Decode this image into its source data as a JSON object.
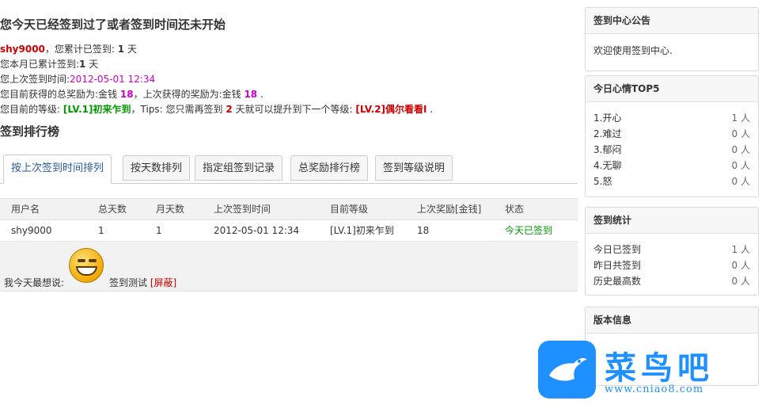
{
  "header": {
    "title": "您今天已经签到过了或者签到时间还未开始"
  },
  "info": {
    "username": "shy9000",
    "total_prefix": "，您累计已签到:",
    "total_days": "1",
    "day_unit": "天",
    "month_prefix": "您本月已累计签到:",
    "month_days": "1",
    "last_prefix": "您上次签到时间:",
    "last_time": "2012-05-01 12:34",
    "reward_prefix": "您目前获得的总奖励为:金钱",
    "reward_total": "18",
    "reward_mid": "，上次获得的奖励为:金钱",
    "reward_last": "18",
    "level_prefix": "您目前的等级:",
    "level_current": "[LV.1]初来乍到",
    "tips_prefix": "，Tips: 您只需再签到",
    "tips_days": "2",
    "tips_mid": "天就可以提升到下一个等级:",
    "level_next": "[LV.2]偶尔看看I",
    "period": "."
  },
  "rank": {
    "title": "签到排行榜",
    "tabs": [
      "按上次签到时间排列",
      "按天数排列",
      "指定组签到记录",
      "总奖励排行榜",
      "签到等级说明"
    ],
    "columns": [
      "用户名",
      "总天数",
      "月天数",
      "上次签到时间",
      "目前等级",
      "上次奖励[金钱]",
      "状态"
    ],
    "rows": [
      [
        "shy9000",
        "1",
        "1",
        "2012-05-01 12:34",
        "[LV.1]初来乍到",
        "18",
        "今天已签到"
      ]
    ]
  },
  "mood": {
    "label": "我今天最想说:",
    "text": "签到测试",
    "mask": "[屏蔽]"
  },
  "sidebar": {
    "notice_title": "签到中心公告",
    "notice_text": "欢迎使用签到中心.",
    "top5_title": "今日心情TOP5",
    "top5": [
      {
        "label": "1.开心",
        "value": "1 人"
      },
      {
        "label": "2.难过",
        "value": "0 人"
      },
      {
        "label": "3.郁闷",
        "value": "0 人"
      },
      {
        "label": "4.无聊",
        "value": "0 人"
      },
      {
        "label": "5.怒",
        "value": "0 人"
      }
    ],
    "stats_title": "签到统计",
    "stats": [
      {
        "label": "今日已签到",
        "value": "1 人"
      },
      {
        "label": "昨日共签到",
        "value": "0 人"
      },
      {
        "label": "历史最高数",
        "value": "0 人"
      }
    ],
    "version_title": "版本信息"
  },
  "watermark": {
    "name": "菜鸟吧",
    "url": "www.cniao8.com",
    "color": "#1e90ff"
  }
}
